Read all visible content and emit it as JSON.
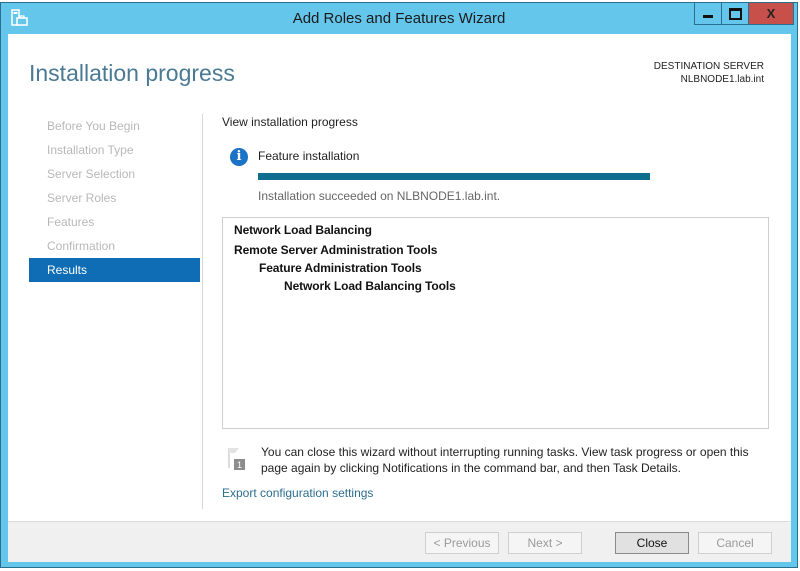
{
  "window": {
    "title": "Add Roles and Features Wizard",
    "controls": {
      "minimize": "minimize",
      "maximize": "maximize",
      "close": "X"
    }
  },
  "header": {
    "page_title": "Installation progress",
    "destination_label": "DESTINATION SERVER",
    "destination_server": "NLBNODE1.lab.int"
  },
  "sidebar": {
    "steps": [
      {
        "label": "Before You Begin",
        "active": false
      },
      {
        "label": "Installation Type",
        "active": false
      },
      {
        "label": "Server Selection",
        "active": false
      },
      {
        "label": "Server Roles",
        "active": false
      },
      {
        "label": "Features",
        "active": false
      },
      {
        "label": "Confirmation",
        "active": false
      },
      {
        "label": "Results",
        "active": true
      }
    ]
  },
  "main": {
    "section_label": "View installation progress",
    "feature_label": "Feature installation",
    "progress_percent": 100,
    "status_text": "Installation succeeded on NLBNODE1.lab.int.",
    "results": [
      {
        "label": "Network Load Balancing",
        "level": 0
      },
      {
        "label": "Remote Server Administration Tools",
        "level": 0
      },
      {
        "label": "Feature Administration Tools",
        "level": 1
      },
      {
        "label": "Network Load Balancing Tools",
        "level": 2
      }
    ],
    "notice": "You can close this wizard without interrupting running tasks. View task progress or open this page again by clicking Notifications in the command bar, and then Task Details.",
    "notification_count": "1",
    "export_link": "Export configuration settings"
  },
  "footer": {
    "previous": "< Previous",
    "next": "Next >",
    "close": "Close",
    "cancel": "Cancel"
  },
  "colors": {
    "titlebar": "#65c6ec",
    "accent": "#0f6db5",
    "progress": "#0f6e8f",
    "close_button": "#c7504b",
    "link": "#2c6e8e"
  }
}
